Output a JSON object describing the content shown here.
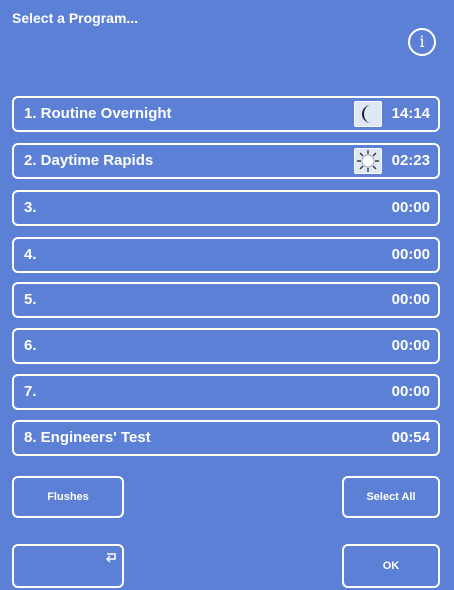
{
  "header": {
    "title": "Select a Program..."
  },
  "info_button": {
    "glyph": "i"
  },
  "programs": [
    {
      "label": "1. Routine Overnight",
      "time": "14:14",
      "icon": "moon-icon"
    },
    {
      "label": "2. Daytime Rapids",
      "time": "02:23",
      "icon": "sun-icon"
    },
    {
      "label": "3.",
      "time": "00:00"
    },
    {
      "label": "4.",
      "time": "00:00"
    },
    {
      "label": "5.",
      "time": "00:00"
    },
    {
      "label": "6.",
      "time": "00:00"
    },
    {
      "label": "7.",
      "time": "00:00"
    },
    {
      "label": "8. Engineers' Test",
      "time": "00:54"
    }
  ],
  "buttons": {
    "flushes": "Flushes",
    "select_all": "Select All",
    "back_icon": "return-arrow-icon",
    "ok": "OK"
  },
  "colors": {
    "background": "#5b80d6",
    "border": "#ffffff",
    "text": "#ffffff",
    "icon_bg": "#dfe8f7"
  }
}
